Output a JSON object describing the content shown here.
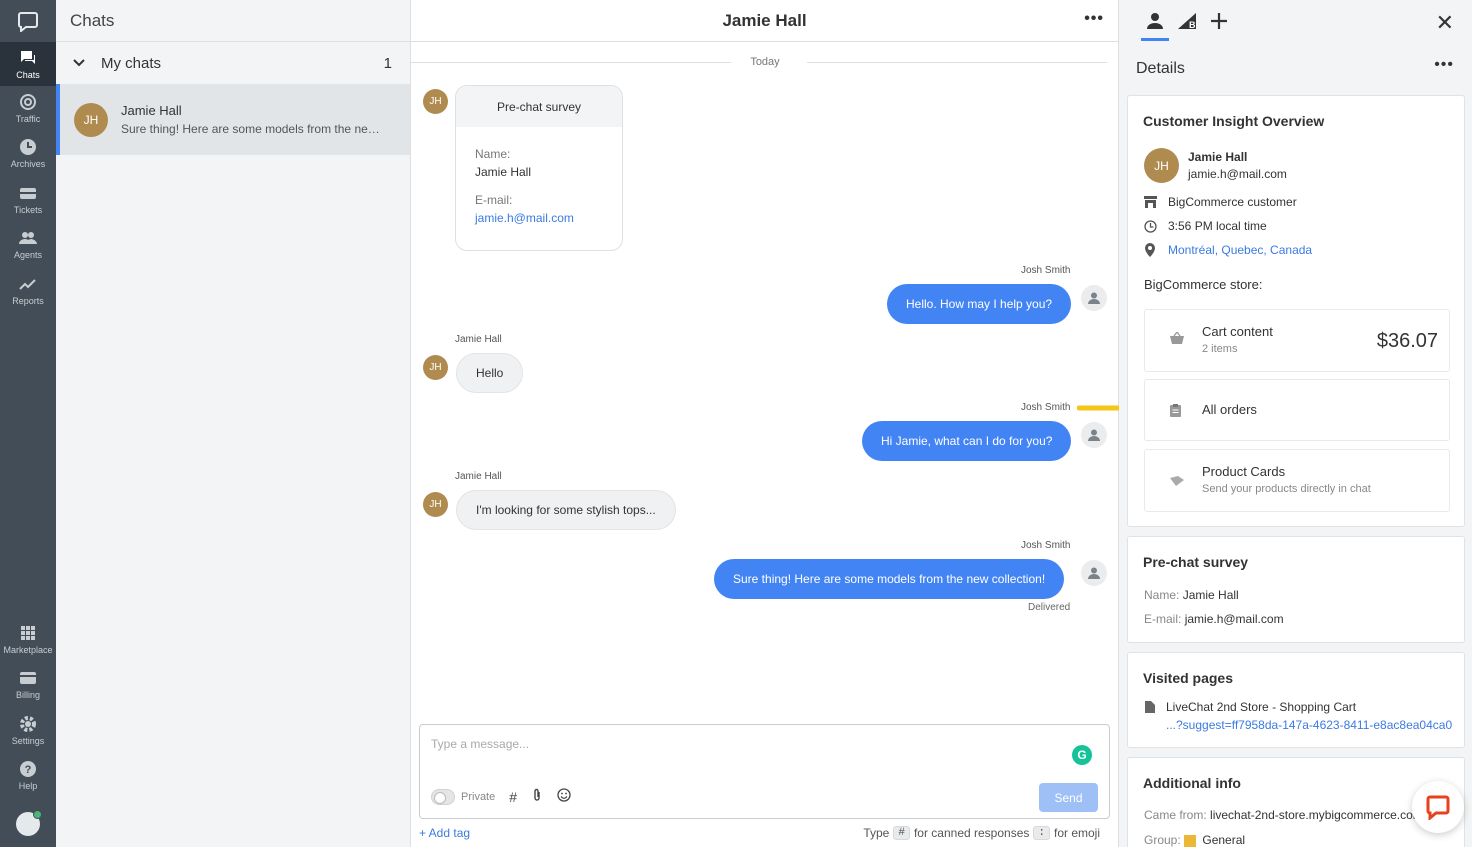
{
  "nav": {
    "items": [
      {
        "label": "Chats",
        "icon": "chats-icon"
      },
      {
        "label": "Traffic",
        "icon": "traffic-icon"
      },
      {
        "label": "Archives",
        "icon": "archives-icon"
      },
      {
        "label": "Tickets",
        "icon": "tickets-icon"
      },
      {
        "label": "Agents",
        "icon": "agents-icon"
      },
      {
        "label": "Reports",
        "icon": "reports-icon"
      }
    ],
    "bottom": [
      {
        "label": "Marketplace"
      },
      {
        "label": "Billing"
      },
      {
        "label": "Settings"
      },
      {
        "label": "Help"
      }
    ]
  },
  "list": {
    "title": "Chats",
    "group_label": "My chats",
    "group_count": "1",
    "chat": {
      "initials": "JH",
      "name": "Jamie Hall",
      "preview": "Sure thing! Here are some models from the new collection!"
    }
  },
  "conversation": {
    "title": "Jamie Hall",
    "day_label": "Today",
    "survey": {
      "title": "Pre-chat survey",
      "name_label": "Name:",
      "name_value": "Jamie Hall",
      "email_label": "E-mail:",
      "email_value": "jamie.h@mail.com"
    },
    "messages": [
      {
        "author": "Josh Smith",
        "text": "Hello. How may I help you?"
      },
      {
        "author": "Jamie Hall",
        "text": "Hello"
      },
      {
        "author": "Josh Smith",
        "text": "Hi Jamie, what can I do for you?"
      },
      {
        "author": "Jamie Hall",
        "text": "I'm looking for some stylish tops..."
      },
      {
        "author": "Josh Smith",
        "text": "Sure thing! Here are some models from the new collection!"
      }
    ],
    "avatar_initials": "JH",
    "delivered": "Delivered",
    "composer": {
      "placeholder": "Type a message...",
      "private_label": "Private",
      "send_label": "Send",
      "add_tag": "+ Add tag",
      "hint_type": "Type",
      "hint_hash": "#",
      "hint_canned": "for canned responses",
      "hint_colon": ":",
      "hint_emoji": "for emoji"
    }
  },
  "details": {
    "title": "Details",
    "insight": {
      "title": "Customer Insight Overview",
      "initials": "JH",
      "name": "Jamie Hall",
      "email": "jamie.h@mail.com",
      "customer_type": "BigCommerce customer",
      "local_time": "3:56 PM local time",
      "location": "Montréal, Quebec, Canada",
      "store_label": "BigCommerce store:",
      "cart_title": "Cart content",
      "cart_items": "2 items",
      "cart_total": "$36.07",
      "orders_label": "All orders",
      "product_cards_title": "Product Cards",
      "product_cards_desc": "Send your products directly in chat"
    },
    "survey": {
      "title": "Pre-chat survey",
      "name_label": "Name:",
      "name_value": "Jamie Hall",
      "email_label": "E-mail:",
      "email_value": "jamie.h@mail.com"
    },
    "visited": {
      "title": "Visited pages",
      "page_title": "LiveChat 2nd Store - Shopping Cart",
      "page_url": "...?suggest=ff7958da-147a-4623-8411-e8ac8ea04ca0"
    },
    "additional": {
      "title": "Additional info",
      "came_from_label": "Came from:",
      "came_from_value": "livechat-2nd-store.mybigcommerce.com",
      "group_label": "Group:",
      "group_value": "General"
    }
  },
  "colors": {
    "accent": "#4384f5",
    "nav_bg": "#424d57",
    "avatar": "#b08b4f",
    "arrow": "#f5c518"
  }
}
